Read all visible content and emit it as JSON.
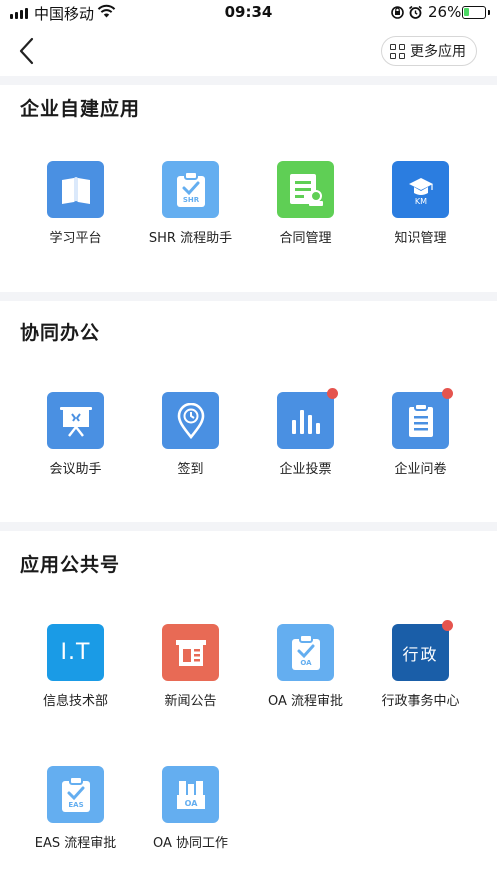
{
  "status_bar": {
    "carrier": "中国移动",
    "time": "09:34",
    "battery_percent": "26%",
    "battery_level": 0.26,
    "icons": [
      "signal-icon",
      "wifi-icon",
      "rotation-lock-icon",
      "alarm-icon",
      "battery-charging-icon"
    ]
  },
  "nav": {
    "back_icon": "chevron-left-icon",
    "more_apps_label": "更多应用",
    "more_apps_icon": "grid-icon"
  },
  "sections": [
    {
      "title": "企业自建应用",
      "apps": [
        {
          "label": "学习平台",
          "icon": "book-icon",
          "color": "#4a90e2",
          "badge": false
        },
        {
          "label": "SHR 流程助手",
          "icon": "clipboard-check-icon",
          "icon_text": "SHR",
          "color": "#64aef0",
          "badge": false
        },
        {
          "label": "合同管理",
          "icon": "contract-stamp-icon",
          "color": "#5fcf55",
          "badge": false
        },
        {
          "label": "知识管理",
          "icon": "graduation-cap-icon",
          "icon_text": "KM",
          "color": "#2b7de0",
          "badge": false
        }
      ]
    },
    {
      "title": "协同办公",
      "apps": [
        {
          "label": "会议助手",
          "icon": "presentation-board-icon",
          "color": "#4a90e2",
          "badge": false
        },
        {
          "label": "签到",
          "icon": "location-clock-icon",
          "color": "#4a90e2",
          "badge": false
        },
        {
          "label": "企业投票",
          "icon": "bar-chart-icon",
          "color": "#4a90e2",
          "badge": true
        },
        {
          "label": "企业问卷",
          "icon": "questionnaire-icon",
          "color": "#4a90e2",
          "badge": true
        }
      ]
    },
    {
      "title": "应用公共号",
      "apps": [
        {
          "label": "信息技术部",
          "icon": "it-text-icon",
          "icon_text": "I.T",
          "color": "#1a9be6",
          "badge": false
        },
        {
          "label": "新闻公告",
          "icon": "newspaper-icon",
          "color": "#e86a55",
          "badge": false
        },
        {
          "label": "OA 流程审批",
          "icon": "clipboard-check-icon",
          "icon_text": "OA",
          "color": "#64aef0",
          "badge": false
        },
        {
          "label": "行政事务中心",
          "icon": "admin-text-icon",
          "icon_text": "行政",
          "color": "#1a5ea8",
          "badge": true
        },
        {
          "label": "EAS 流程审批",
          "icon": "clipboard-check-icon",
          "icon_text": "EAS",
          "color": "#64aef0",
          "badge": false
        },
        {
          "label": "OA 协同工作",
          "icon": "factory-icon",
          "icon_text": "OA",
          "color": "#64aef0",
          "badge": false
        }
      ]
    }
  ]
}
